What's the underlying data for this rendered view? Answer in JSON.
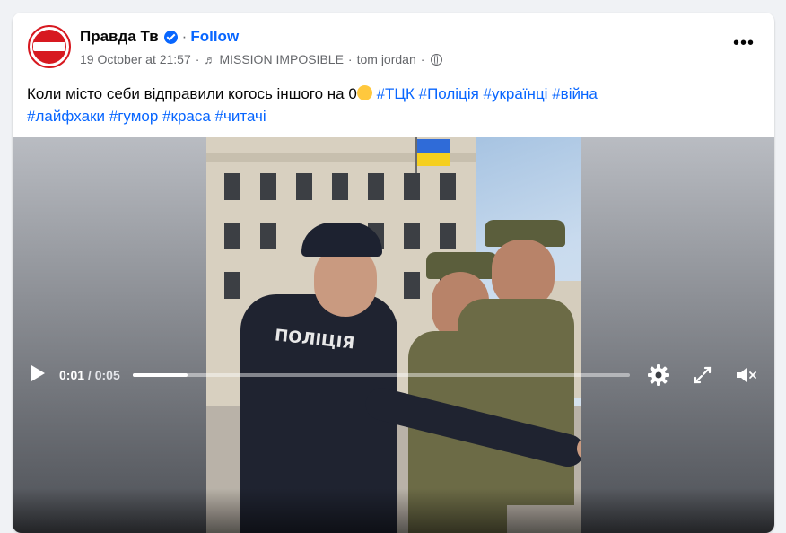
{
  "post": {
    "page_name": "Правда Тв",
    "follow_label": "Follow",
    "date": "19 October at 21:57",
    "music_title": "MISSION IMPOSIBLE",
    "music_artist": "tom jordan",
    "caption_text": "Коли місто себи відправили когось іншого на 0",
    "hashtags_line1": [
      "#ТЦК",
      "#Поліція",
      "#українці",
      "#війна"
    ],
    "hashtags_line2": [
      "#лайфхаки",
      "#гумор",
      "#краса",
      "#читачі"
    ],
    "more_label": "•••"
  },
  "video": {
    "flag_colors": {
      "blue": "#2f6bd8",
      "yellow": "#f5cf1f"
    },
    "uniform_label": "ПОЛІЦІЯ",
    "current_time": "0:01",
    "separator": "/",
    "total_time": "0:05",
    "progress": 0.11,
    "icons": {
      "play": "play-icon",
      "settings": "gear-icon",
      "fullscreen": "expand-icon",
      "volume": "muted-speaker-icon"
    }
  },
  "colors": {
    "link": "#0866ff",
    "text": "#050505",
    "secondary": "#65676b",
    "avatar_red": "#d71920"
  }
}
